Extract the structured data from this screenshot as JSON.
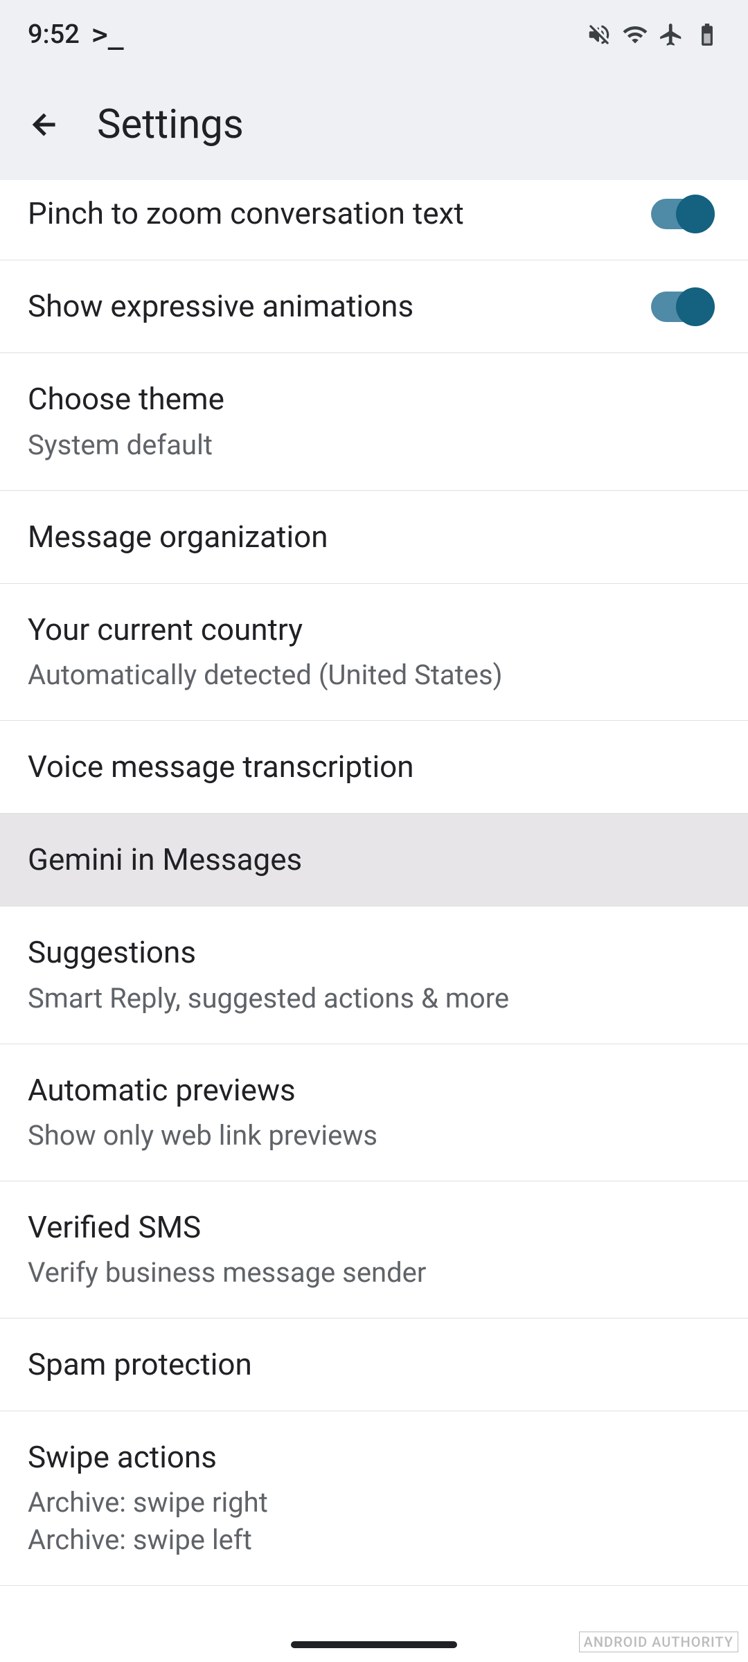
{
  "status_bar": {
    "time": "9:52",
    "prompt": ">_"
  },
  "app_bar": {
    "title": "Settings"
  },
  "settings": {
    "pinch_zoom": {
      "title": "Pinch to zoom conversation text",
      "enabled": true
    },
    "expressive_animations": {
      "title": "Show expressive animations",
      "enabled": true
    },
    "theme": {
      "title": "Choose theme",
      "subtitle": "System default"
    },
    "message_organization": {
      "title": "Message organization"
    },
    "country": {
      "title": "Your current country",
      "subtitle": "Automatically detected (United States)"
    },
    "voice_transcription": {
      "title": "Voice message transcription"
    },
    "gemini": {
      "title": "Gemini in Messages"
    },
    "suggestions": {
      "title": "Suggestions",
      "subtitle": "Smart Reply, suggested actions & more"
    },
    "auto_previews": {
      "title": "Automatic previews",
      "subtitle": "Show only web link previews"
    },
    "verified_sms": {
      "title": "Verified SMS",
      "subtitle": "Verify business message sender"
    },
    "spam_protection": {
      "title": "Spam protection"
    },
    "swipe_actions": {
      "title": "Swipe actions",
      "subtitle_1": "Archive: swipe right",
      "subtitle_2": "Archive: swipe left"
    }
  },
  "watermark": "ANDROID AUTHORITY"
}
